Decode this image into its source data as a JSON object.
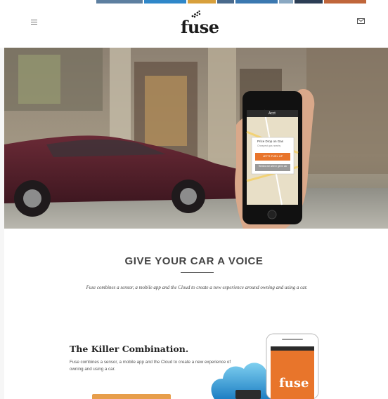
{
  "header": {
    "logo_text": "fuse",
    "menu_icon": "hamburger-menu-icon",
    "mail_icon": "envelope-icon"
  },
  "hero": {
    "phone_screen": {
      "status": "Acct",
      "card_title": "Price Drop on Gas",
      "card_subtitle": "Cheapest gas nearby",
      "primary_button": "LET'S FUEL UP",
      "secondary_button": "Remind me when I get in car"
    }
  },
  "voice_section": {
    "heading": "GIVE YOUR CAR A VOICE",
    "description": "Fuse combines a sensor, a mobile app and the Cloud to create a new experience around owning and using a car."
  },
  "killer_section": {
    "title": "The Killer Combination.",
    "description": "Fuse combines a sensor, a mobile app and the Cloud to create a new experience of owning and using a car.",
    "phone_logo": "fuse"
  },
  "colors": {
    "accent_orange": "#e8752b",
    "button_orange": "#e79e4b",
    "heading_gray": "#444444"
  }
}
